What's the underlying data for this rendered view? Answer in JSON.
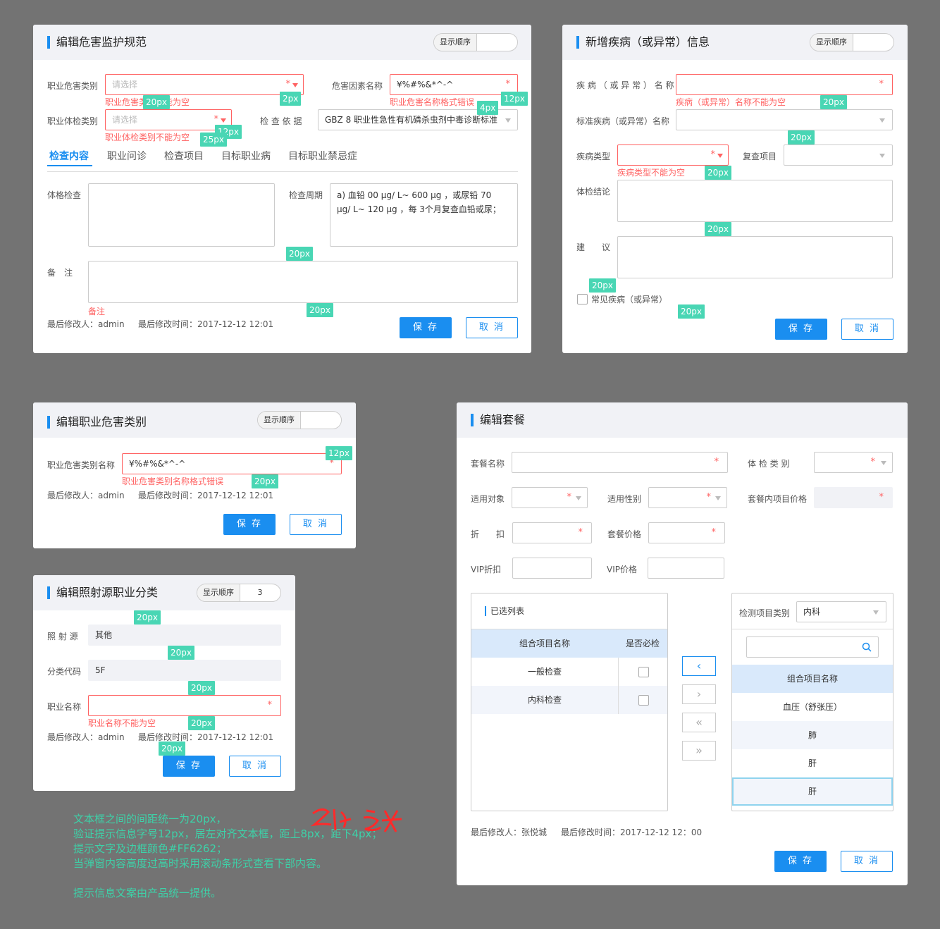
{
  "common": {
    "order_label": "显示顺序",
    "save": "保 存",
    "cancel": "取 消",
    "modifier": "最后修改人：admin",
    "mtime": "最后修改时间：2017-12-12  12:01",
    "placeholder": "请选择",
    "star": "*"
  },
  "p1": {
    "title": "编辑危害监护规范",
    "hazard_cat_label": "职业危害类别",
    "hazard_cat_err": "职业危害类别不能为空",
    "factor_label": "危害因素名称",
    "factor_value": "¥%#%&*^-^",
    "factor_err": "职业危害名称格式错误",
    "exam_cat_label": "职业体检类别",
    "exam_cat_err": "职业体检类别不能为空",
    "basis_label": "检 查 依 据",
    "basis_value": "GBZ 8 职业性急性有机磷杀虫剂中毒诊断标准",
    "tabs": [
      "检查内容",
      "职业问诊",
      "检查项目",
      "目标职业病",
      "目标职业禁忌症"
    ],
    "physical_label": "体格检查",
    "period_label": "检查周期",
    "period_value": "a) 血铅 00 μg/ L~ 600 μg ，或尿铅 70 μg/ L~ 120 μg ，每 3个月复查血铅或尿；",
    "remark_label": "备　注",
    "remark_err": "备注"
  },
  "p2": {
    "title": "新增疾病（或异常）信息",
    "disease_name_label": "疾 病 （ 或 异 常 ） 名 称",
    "disease_name_err": "疾病（或异常）名称不能为空",
    "std_name_label": "标准疾病（或异常）名称",
    "disease_type_label": "疾病类型",
    "disease_type_err": "疾病类型不能为空",
    "recheck_label": "复查项目",
    "conclusion_label": "体检结论",
    "advice_label": "建　　议",
    "common_disease_label": "常见疾病（或异常）"
  },
  "p3": {
    "title": "编辑职业危害类别",
    "name_label": "职业危害类别名称",
    "name_value": "¥%#%&*^-^",
    "name_err": "职业危害类别名称格式错误"
  },
  "p4": {
    "title": "编辑照射源职业分类",
    "order_value": "3",
    "source_label": "照 射 源",
    "source_value": "其他",
    "code_label": "分类代码",
    "code_value": "5F",
    "job_label": "职业名称",
    "job_err": "职业名称不能为空"
  },
  "p5": {
    "title": "编辑套餐",
    "pkg_name_label": "套餐名称",
    "exam_type_label": "体 检 类 别",
    "target_label": "适用对象",
    "gender_label": "适用性别",
    "inner_price_label": "套餐内项目价格",
    "discount_label": "折　　扣",
    "pkg_price_label": "套餐价格",
    "vip_discount_label": "VIP折扣",
    "vip_price_label": "VIP价格",
    "selected_title": "已选列表",
    "col_name": "组合项目名称",
    "col_required": "是否必检",
    "selected_rows": [
      "一般检查",
      "内科检查"
    ],
    "category_label": "检测项目类别",
    "category_value": "内科",
    "right_col": "组合项目名称",
    "right_rows": [
      "血压（舒张压）",
      "肺",
      "肝",
      "肝"
    ],
    "modifier": "最后修改人：张悦城",
    "mtime": "最后修改时间：2017-12-12  12：00"
  },
  "spacing_tags": {
    "t20": "20px",
    "t2": "2px",
    "t4": "4px",
    "t12": "12px",
    "t25": "25px"
  },
  "notes": {
    "line1": "文本框之间的间距统一为20px，",
    "line2": "验证提示信息字号12px，居左对齐文本框，距上8px，距下4px；",
    "line3": "提示文字及边框颜色#FF6262；",
    "line4": "当弹窗内容高度过高时采用滚动条形式查看下部内容。",
    "line5": "提示信息文案由产品统一提供。"
  },
  "colors": {
    "background": "#737373",
    "accent": "#1a8ef0",
    "error": "#FF6262",
    "spacing_tag": "#49d6b4",
    "header": "#f1f2f6"
  }
}
